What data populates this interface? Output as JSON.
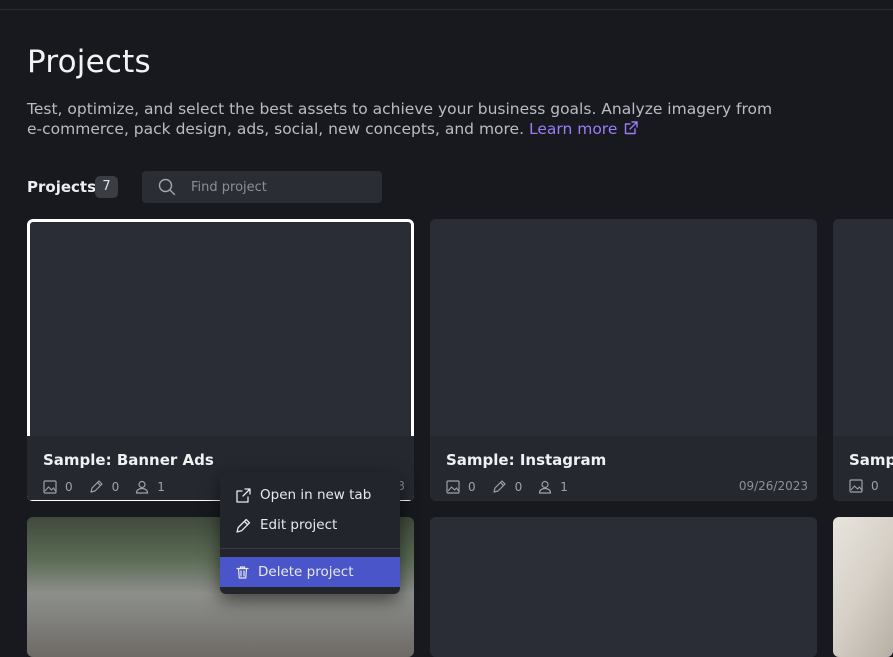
{
  "page": {
    "title": "Projects",
    "description": "Test, optimize, and select the best assets to achieve your business goals. Analyze imagery from e-commerce, pack design, ads, social, new concepts, and more.",
    "learn_more": "Learn more"
  },
  "toolbar": {
    "projects_label": "Projects",
    "projects_count": "7",
    "search_placeholder": "Find project"
  },
  "projects": [
    {
      "name": "Sample: Banner Ads",
      "images": "0",
      "tags": "0",
      "users": "1",
      "date": "3"
    },
    {
      "name": "Sample: Instagram",
      "images": "0",
      "tags": "0",
      "users": "1",
      "date": "09/26/2023"
    },
    {
      "name": "Sampl",
      "images": "0"
    }
  ],
  "context_menu": {
    "open_new_tab": "Open in new tab",
    "edit_project": "Edit project",
    "delete_project": "Delete project"
  },
  "colors": {
    "background": "#18191e",
    "card": "#292b33",
    "accent_link": "#9a7cf7",
    "menu_highlight": "#4a55c9"
  },
  "icons": [
    "search-icon",
    "external-link-icon",
    "image-icon",
    "pencil-icon",
    "user-icon",
    "trash-icon"
  ]
}
